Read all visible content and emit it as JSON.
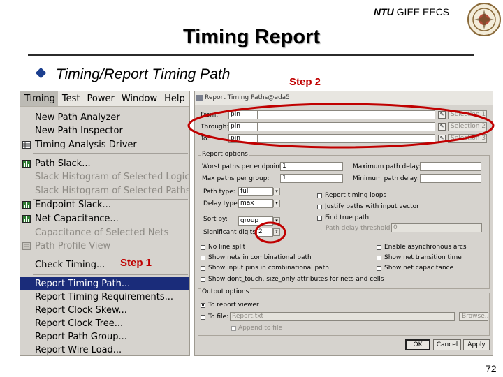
{
  "slide": {
    "org_bold": "NTU",
    "org_rest": "GIEE EECS",
    "title": "Timing Report",
    "bullet": "Timing/Report Timing Path",
    "step1": "Step 1",
    "step2": "Step 2",
    "page_number": "72",
    "logo_icon": "university-seal-icon",
    "accent_color": "#c00000",
    "bullet_color": "#1c3f8f"
  },
  "menu": {
    "menubar": [
      "Timing",
      "Test",
      "Power",
      "Window",
      "Help"
    ],
    "active_menu": "Timing",
    "items": [
      {
        "label": "New Path Analyzer",
        "icon": "",
        "disabled": false
      },
      {
        "label": "New Path Inspector",
        "icon": "",
        "disabled": false
      },
      {
        "label": "Timing Analysis Driver",
        "icon": "table-icon",
        "disabled": false
      },
      {
        "label": "Path Slack...",
        "icon": "histogram-icon",
        "disabled": false
      },
      {
        "label": "Slack Histogram of Selected Logic",
        "icon": "",
        "disabled": true
      },
      {
        "label": "Slack Histogram of Selected Paths",
        "icon": "",
        "disabled": true
      },
      {
        "label": "Endpoint Slack...",
        "icon": "histogram-icon",
        "disabled": false
      },
      {
        "label": "Net Capacitance...",
        "icon": "histogram-icon",
        "disabled": false
      },
      {
        "label": "Capacitance of Selected Nets",
        "icon": "",
        "disabled": true
      },
      {
        "label": "Path Profile View",
        "icon": "profile-icon",
        "disabled": true
      },
      {
        "label": "Check Timing...",
        "icon": "",
        "disabled": false
      },
      {
        "label": "Report Timing Path...",
        "icon": "",
        "disabled": false,
        "selected": true
      },
      {
        "label": "Report Timing Requirements...",
        "icon": "",
        "disabled": false
      },
      {
        "label": "Report Clock Skew...",
        "icon": "",
        "disabled": false
      },
      {
        "label": "Report Clock Tree...",
        "icon": "",
        "disabled": false
      },
      {
        "label": "Report Path Group...",
        "icon": "",
        "disabled": false
      },
      {
        "label": "Report Wire Load...",
        "icon": "",
        "disabled": false
      }
    ]
  },
  "dialog": {
    "title": "Report Timing Paths@eda5",
    "paths": [
      {
        "label": "From:",
        "type": "pin",
        "selection": "Selection 1"
      },
      {
        "label": "Through:",
        "type": "pin",
        "selection": "Selection 2"
      },
      {
        "label": "To:",
        "type": "pin",
        "selection": "Selection 3"
      }
    ],
    "report_options_label": "Report options",
    "worst_paths_label": "Worst paths per endpoint:",
    "worst_paths_value": "1",
    "max_paths_label": "Max paths per group:",
    "max_paths_value": "1",
    "max_path_delay_label": "Maximum path delay:",
    "min_path_delay_label": "Minimum path delay:",
    "path_type_label": "Path type:",
    "path_type_value": "full",
    "delay_type_label": "Delay type:",
    "delay_type_value": "max",
    "sort_by_label": "Sort by:",
    "sort_by_value": "group",
    "sig_digits_label": "Significant digits:",
    "sig_digits_value": "2",
    "right_checks": [
      {
        "label": "Report timing loops",
        "checked": false
      },
      {
        "label": "Justify paths with input vector",
        "checked": false
      },
      {
        "label": "Find true path",
        "checked": false
      }
    ],
    "path_delay_threshold_label": "Path delay threshold:",
    "path_delay_threshold_value": "0",
    "lower_checks_left": [
      {
        "label": "No line split",
        "checked": false
      },
      {
        "label": "Show nets in combinational path",
        "checked": false
      },
      {
        "label": "Show input pins in combinational path",
        "checked": false
      },
      {
        "label": "Show dont_touch, size_only attributes for nets and cells",
        "checked": false
      }
    ],
    "lower_checks_right": [
      {
        "label": "Enable asynchronous arcs",
        "checked": false
      },
      {
        "label": "Show net transition time",
        "checked": false
      },
      {
        "label": "Show net capacitance",
        "checked": false
      }
    ],
    "output_options_label": "Output options",
    "to_viewer_label": "To report viewer",
    "to_file_label": "To file:",
    "file_value": "Report.txt",
    "browse_label": "Browse...",
    "append_label": "Append to file",
    "ok_label": "OK",
    "cancel_label": "Cancel",
    "apply_label": "Apply"
  }
}
